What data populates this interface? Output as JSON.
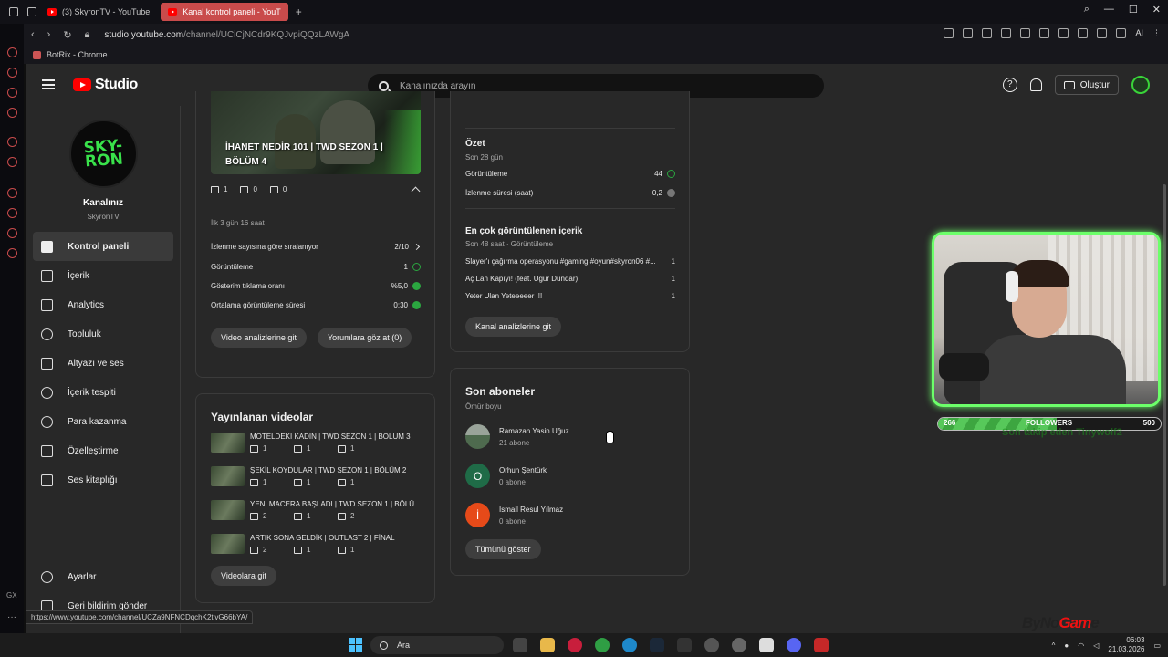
{
  "browser": {
    "tabs": [
      {
        "label": "(3) SkyronTV - YouTube"
      },
      {
        "label": "Kanal kontrol paneli - YouT"
      }
    ],
    "url_prefix": "studio.youtube.com",
    "url_path": "/channel/UCiCjNCdr9KQJvpiQQzLAWgA",
    "bookmark": "BotRix - Chrome...",
    "status_url": "https://www.youtube.com/channel/UCZa9NFNCDqchK2tlvG66bYA/"
  },
  "studio": {
    "logo": "Studio",
    "search_placeholder": "Kanalınızda arayın",
    "create_label": "Oluştur"
  },
  "sidebar": {
    "avatar_text": "SKY-RON",
    "channel_title": "Kanalınız",
    "channel_name": "SkyronTV",
    "items": [
      {
        "label": "Kontrol paneli",
        "icon": "dashboard-icon"
      },
      {
        "label": "İçerik",
        "icon": "content-icon"
      },
      {
        "label": "Analytics",
        "icon": "analytics-icon"
      },
      {
        "label": "Topluluk",
        "icon": "community-icon"
      },
      {
        "label": "Altyazı ve ses",
        "icon": "subtitles-icon"
      },
      {
        "label": "İçerik tespiti",
        "icon": "copyright-icon"
      },
      {
        "label": "Para kazanma",
        "icon": "monetization-icon"
      },
      {
        "label": "Özelleştirme",
        "icon": "customization-icon"
      },
      {
        "label": "Ses kitaplığı",
        "icon": "audio-library-icon"
      }
    ],
    "bottom": [
      {
        "label": "Ayarlar",
        "icon": "settings-icon"
      },
      {
        "label": "Geri bildirim gönder",
        "icon": "feedback-icon"
      }
    ]
  },
  "latest_video": {
    "thumb_title_1": "İHANET NEDİR 101 | TWD SEZON 1 |",
    "thumb_title_2": "BÖLÜM 4",
    "views": "1",
    "comments": "0",
    "likes": "0",
    "period": "İlk 3 gün 16 saat",
    "rows": [
      {
        "label": "İzlenme sayısına göre sıralanıyor",
        "value": "2/10"
      },
      {
        "label": "Görüntüleme",
        "value": "1"
      },
      {
        "label": "Gösterim tıklama oranı",
        "value": "%5,0"
      },
      {
        "label": "Ortalama görüntüleme süresi",
        "value": "0:30"
      }
    ],
    "btn_analytics": "Video analizlerine git",
    "btn_comments": "Yorumlara göz at (0)"
  },
  "published": {
    "title": "Yayınlanan videolar",
    "videos": [
      {
        "title": "MOTELDEKİ KADIN | TWD SEZON 1 | BÖLÜM 3",
        "views": "1",
        "comments": "1",
        "likes": "1"
      },
      {
        "title": "ŞEKİL KOYDULAR | TWD SEZON 1 | BÖLÜM 2",
        "views": "1",
        "comments": "1",
        "likes": "1"
      },
      {
        "title": "YENİ MACERA BAŞLADI | TWD SEZON 1 | BÖLÜ...",
        "views": "2",
        "comments": "1",
        "likes": "2"
      },
      {
        "title": "ARTIK SONA GELDİK | OUTLAST 2 | FİNAL",
        "views": "2",
        "comments": "1",
        "likes": "1"
      }
    ],
    "btn": "Videolara git"
  },
  "analytics": {
    "summary_title": "Özet",
    "summary_period": "Son 28 gün",
    "views_label": "Görüntüleme",
    "views_value": "44",
    "watch_label": "İzlenme süresi (saat)",
    "watch_value": "0,2",
    "top_title": "En çok görüntülenen içerik",
    "top_sub": "Son 48 saat · Görüntüleme",
    "top": [
      {
        "title": "Slayer'ı çağırma operasyonu #gaming #oyun#skyron06 #...",
        "value": "1"
      },
      {
        "title": "Aç Lan Kapıyı! (feat. Uğur Dündar)",
        "value": "1"
      },
      {
        "title": "Yeter Ulan Yeteeeeer !!!",
        "value": "1"
      }
    ],
    "btn": "Kanal analizlerine git"
  },
  "subscribers": {
    "title": "Son aboneler",
    "period": "Ömür boyu",
    "list": [
      {
        "name": "Ramazan Yasin Uğuz",
        "count": "21 abone",
        "initial": "",
        "color": "#6a7a6a"
      },
      {
        "name": "Orhun Şentürk",
        "count": "0 abone",
        "initial": "O",
        "color": "#1f6b47"
      },
      {
        "name": "İsmail Resul Yılmaz",
        "count": "0 abone",
        "initial": "İ",
        "color": "#e64a19"
      }
    ],
    "btn": "Tümünü göster"
  },
  "overlay": {
    "followers_current": "266",
    "followers_label": "FOLLOWERS",
    "followers_goal": "500",
    "followers_progress": 0.532,
    "message": "Son takip eden Tinywolf2",
    "brand_a": "ByNo",
    "brand_b": "Gam",
    "brand_c": "e"
  },
  "taskbar": {
    "search": "Ara",
    "time": "06:03",
    "date": "21.03.2026"
  }
}
